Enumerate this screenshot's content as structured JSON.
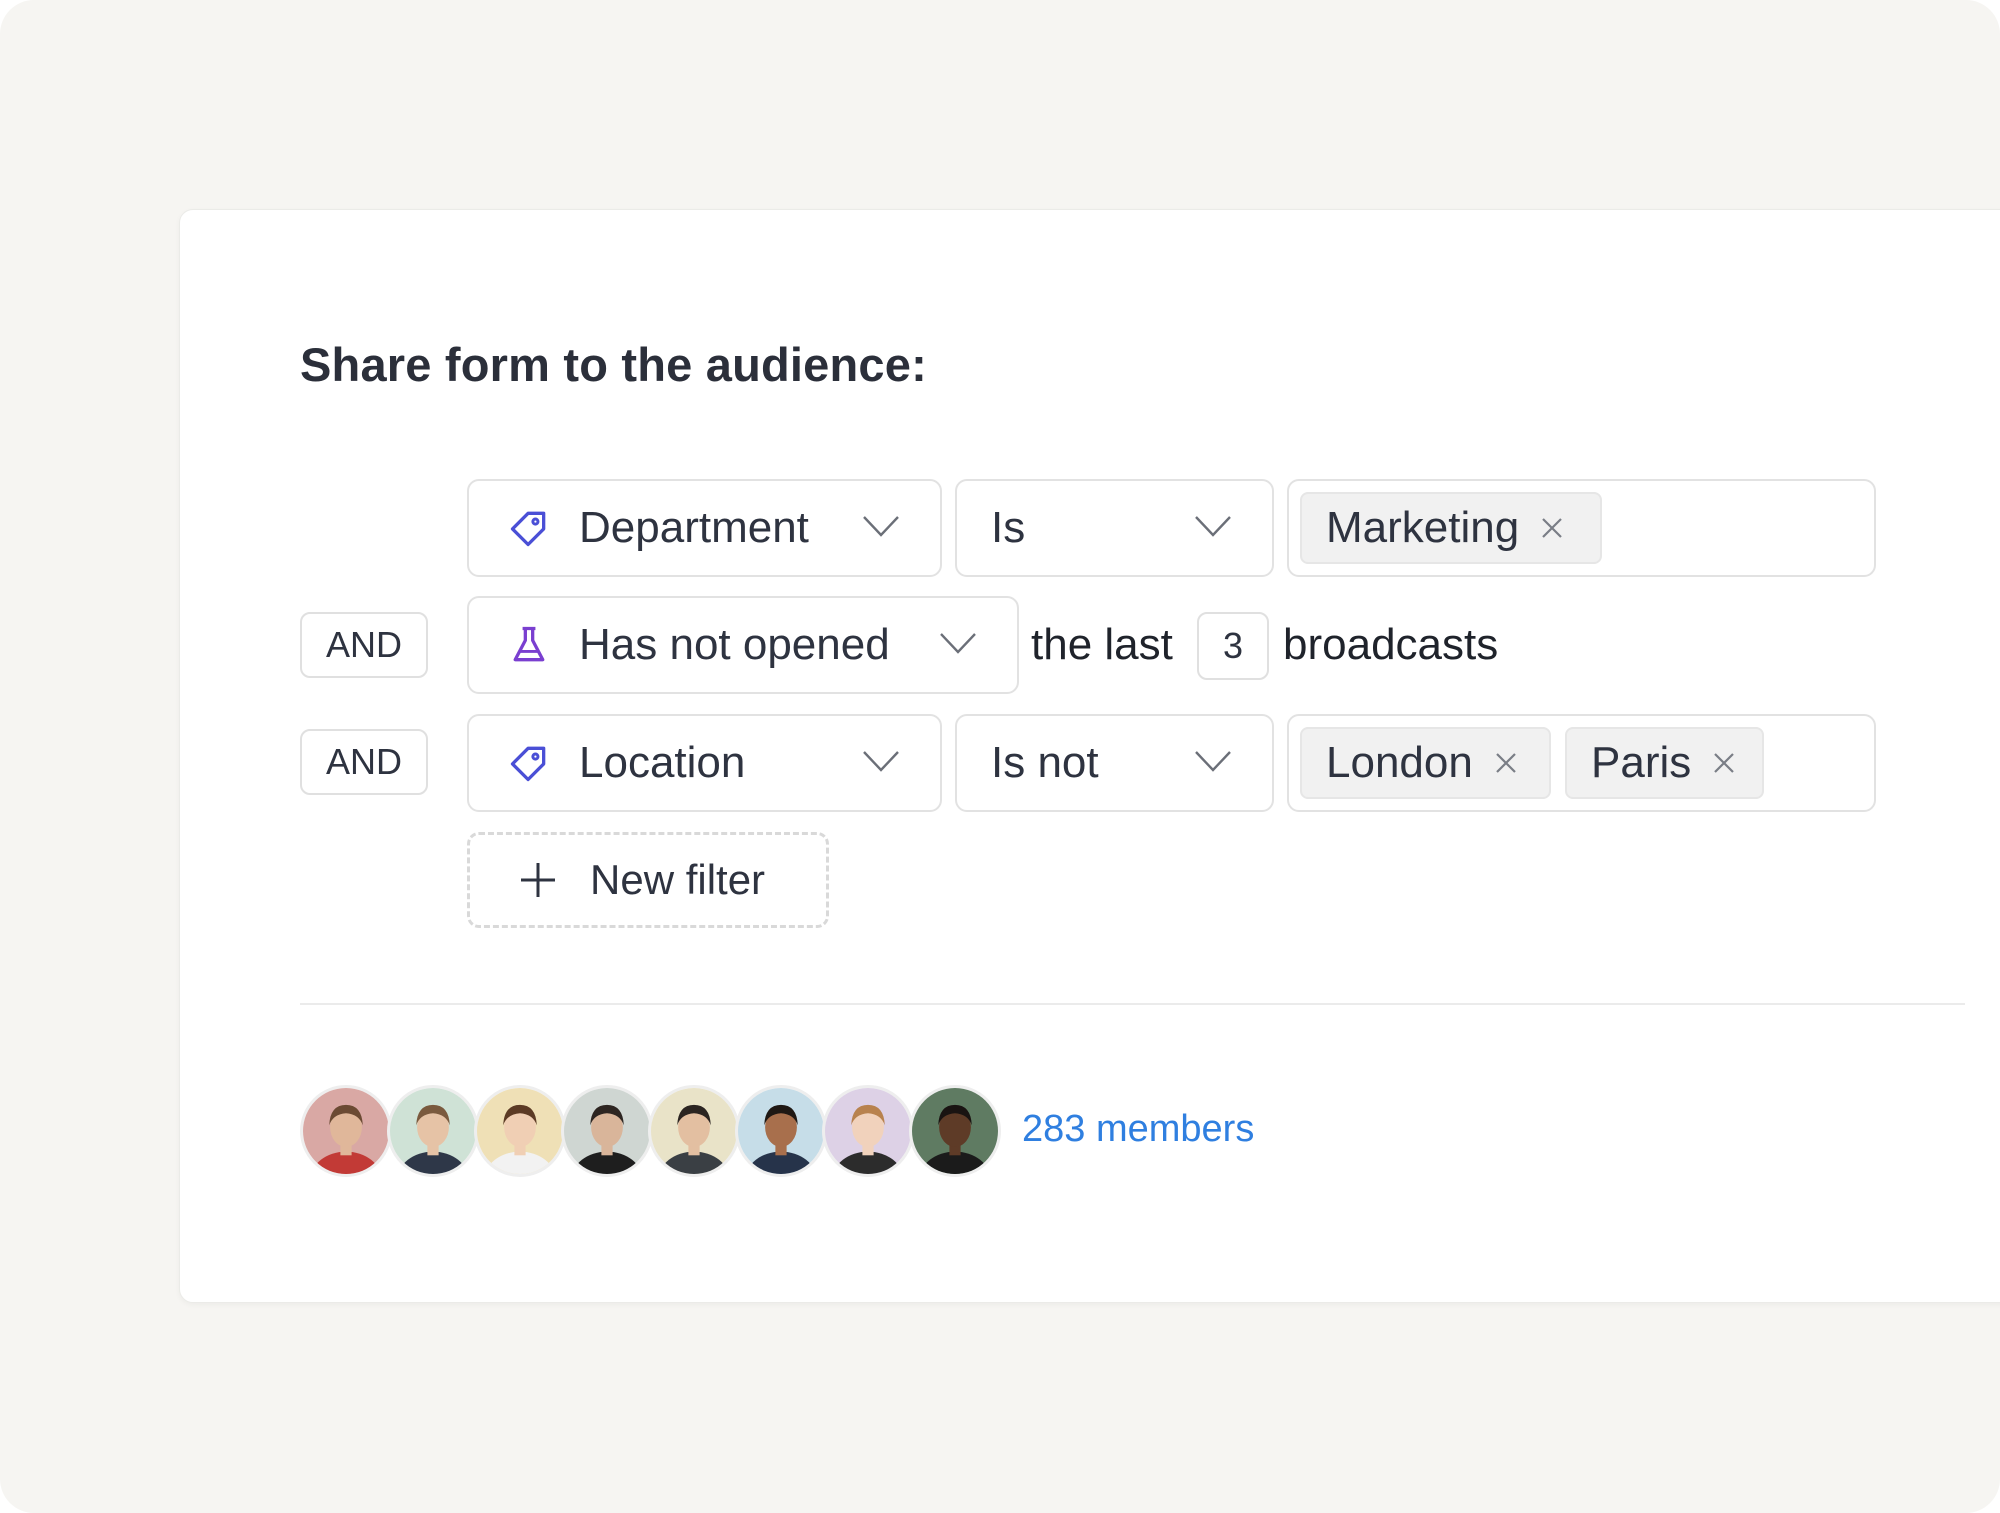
{
  "title": "Share form to the audience:",
  "filters": [
    {
      "connector": "",
      "field": {
        "label": "Department",
        "icon": "tag-icon"
      },
      "operator": {
        "label": "Is"
      },
      "values": [
        "Marketing"
      ]
    },
    {
      "connector": "AND",
      "field": {
        "label": "Has not opened",
        "icon": "flask-icon"
      },
      "suffix_before": "the last",
      "count": "3",
      "suffix_after": "broadcasts"
    },
    {
      "connector": "AND",
      "field": {
        "label": "Location",
        "icon": "tag-icon"
      },
      "operator": {
        "label": "Is not"
      },
      "values": [
        "London",
        "Paris"
      ]
    }
  ],
  "new_filter_label": "New filter",
  "members_label": "283 members",
  "colors": {
    "accent_link": "#2f7fe0",
    "tag_icon": "#4a4fd6",
    "flask_icon": "#7a3fd0"
  },
  "avatars": [
    {
      "bg": "#d9a8a4",
      "skin": "#e0b79a",
      "hair": "#6b4a33",
      "shirt": "#c23a36"
    },
    {
      "bg": "#cfe2d6",
      "skin": "#e6c3a6",
      "hair": "#7a5a3e",
      "shirt": "#2e3748"
    },
    {
      "bg": "#efe0b6",
      "skin": "#f0cfb4",
      "hair": "#5c3b25",
      "shirt": "#f2f2f2"
    },
    {
      "bg": "#cfd6d2",
      "skin": "#d9b59a",
      "hair": "#2d2521",
      "shirt": "#1e1e1e"
    },
    {
      "bg": "#e9e3c8",
      "skin": "#e3bfa1",
      "hair": "#2b2421",
      "shirt": "#3a3f44"
    },
    {
      "bg": "#c6dde8",
      "skin": "#a86f4c",
      "hair": "#1f1814",
      "shirt": "#26334a"
    },
    {
      "bg": "#ddd1e6",
      "skin": "#f1d2bc",
      "hair": "#b8824e",
      "shirt": "#2c2c2c"
    },
    {
      "bg": "#5f7b62",
      "skin": "#5e3b27",
      "hair": "#1a1412",
      "shirt": "#1b1b1b"
    }
  ]
}
